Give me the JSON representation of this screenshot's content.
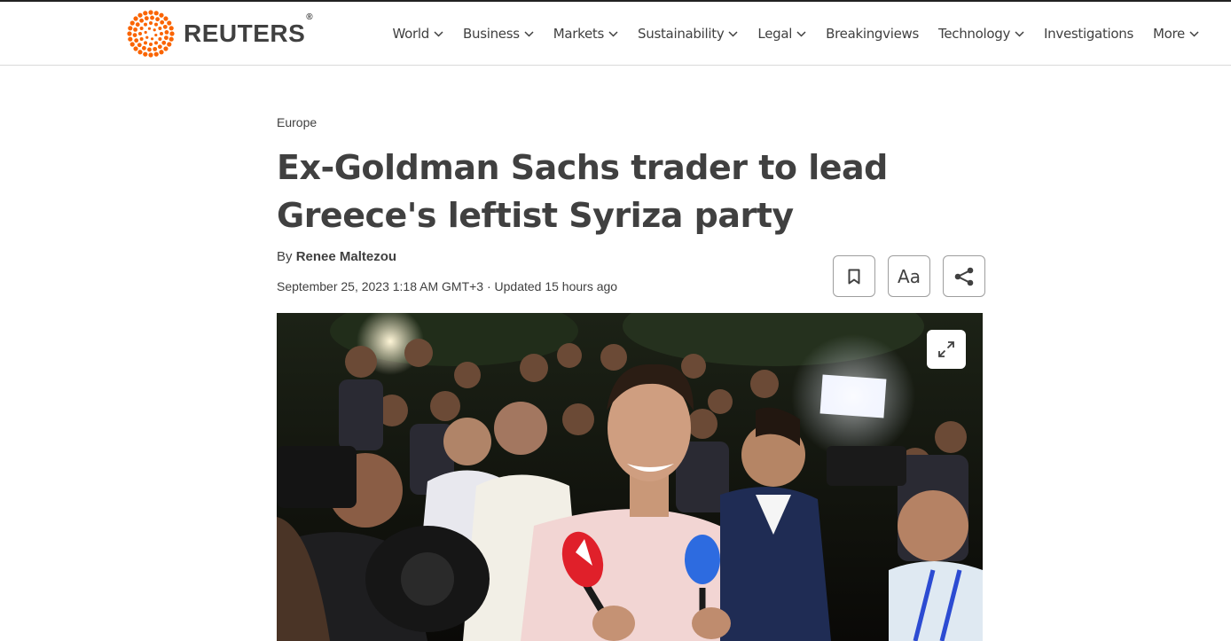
{
  "brand": {
    "name": "REUTERS",
    "reg": "®",
    "accent": "#fa6400"
  },
  "nav": {
    "items": [
      {
        "label": "World",
        "dropdown": true
      },
      {
        "label": "Business",
        "dropdown": true
      },
      {
        "label": "Markets",
        "dropdown": true
      },
      {
        "label": "Sustainability",
        "dropdown": true
      },
      {
        "label": "Legal",
        "dropdown": true
      },
      {
        "label": "Breakingviews",
        "dropdown": false
      },
      {
        "label": "Technology",
        "dropdown": true
      },
      {
        "label": "Investigations",
        "dropdown": false
      },
      {
        "label": "More",
        "dropdown": true
      }
    ]
  },
  "article": {
    "section": "Europe",
    "headline_line1": "Ex-Goldman Sachs trader to lead",
    "headline_line2": "Greece's leftist Syriza party",
    "by_prefix": "By",
    "author": "Renee Maltezou",
    "date": "September 25, 2023 1:18 AM GMT+3 · Updated 15 hours ago"
  },
  "actions": {
    "bookmark_icon": "bookmark-icon",
    "text_size_label": "Aa",
    "share_icon": "share-icon"
  },
  "photo": {
    "expand_icon": "expand-icon"
  }
}
